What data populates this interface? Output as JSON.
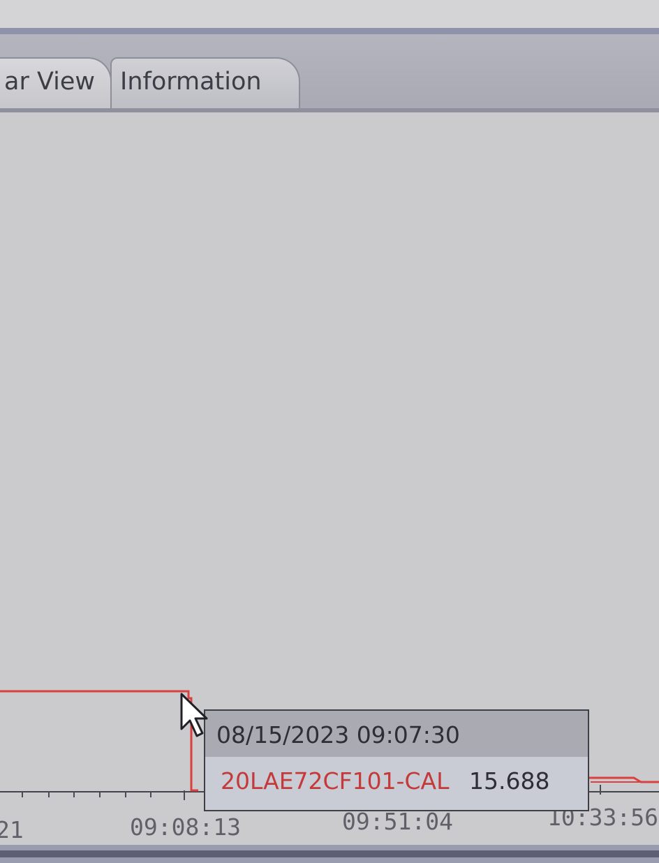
{
  "tabs": [
    {
      "label": "ar View"
    },
    {
      "label": "Information"
    }
  ],
  "chart_data": {
    "type": "line",
    "x_tick_labels": [
      "21",
      "09:08:13",
      "09:51:04",
      "10:33:56"
    ],
    "series": [
      {
        "color": "#d9403f"
      }
    ]
  },
  "tooltip": {
    "timestamp": "08/15/2023 09:07:30",
    "tag": "20LAE72CF101-CAL",
    "value": "15.688"
  },
  "colors": {
    "series": "#d9403f",
    "panel": "#cbcbce",
    "frame": "#8f92aa"
  },
  "icons": {
    "cursor": "pointer-arrow-icon"
  }
}
